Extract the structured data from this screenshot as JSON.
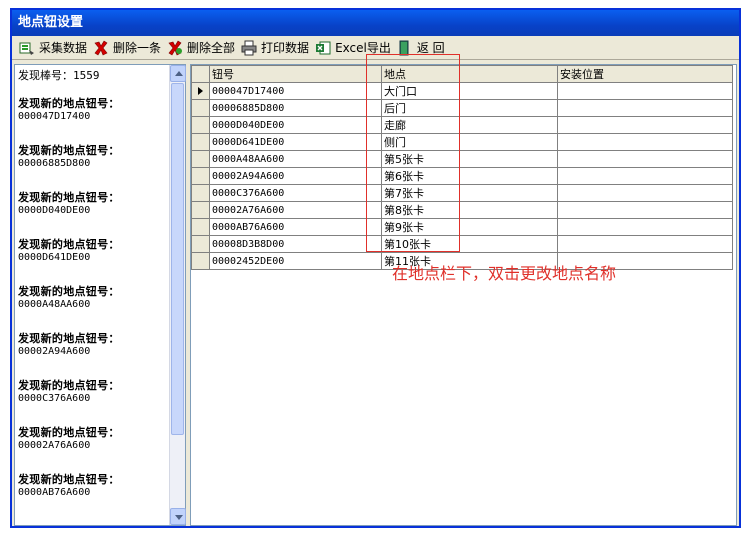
{
  "window": {
    "title": "地点钮设置"
  },
  "toolbar": {
    "collect": "采集数据",
    "delete_one": "删除一条",
    "delete_all": "删除全部",
    "print": "打印数据",
    "excel": "Excel导出",
    "back": "返  回"
  },
  "left_panel": {
    "count_text": "发现棒号：1559",
    "entries": [
      {
        "label": "发现新的地点钮号：",
        "code": "000047D17400"
      },
      {
        "label": "发现新的地点钮号：",
        "code": "00006885D800"
      },
      {
        "label": "发现新的地点钮号：",
        "code": "0000D040DE00"
      },
      {
        "label": "发现新的地点钮号：",
        "code": "0000D641DE00"
      },
      {
        "label": "发现新的地点钮号：",
        "code": "0000A48AA600"
      },
      {
        "label": "发现新的地点钮号：",
        "code": "00002A94A600"
      },
      {
        "label": "发现新的地点钮号：",
        "code": "0000C376A600"
      },
      {
        "label": "发现新的地点钮号：",
        "code": "00002A76A600"
      },
      {
        "label": "发现新的地点钮号：",
        "code": "0000AB76A600"
      }
    ]
  },
  "grid": {
    "headers": [
      "钮号",
      "地点",
      "安装位置"
    ],
    "rows": [
      {
        "code": "000047D17400",
        "loc": "大门口",
        "pos": ""
      },
      {
        "code": "00006885D800",
        "loc": "后门",
        "pos": ""
      },
      {
        "code": "0000D040DE00",
        "loc": "走廊",
        "pos": ""
      },
      {
        "code": "0000D641DE00",
        "loc": "侧门",
        "pos": ""
      },
      {
        "code": "0000A48AA600",
        "loc": "第5张卡",
        "pos": ""
      },
      {
        "code": "00002A94A600",
        "loc": "第6张卡",
        "pos": ""
      },
      {
        "code": "0000C376A600",
        "loc": "第7张卡",
        "pos": ""
      },
      {
        "code": "00002A76A600",
        "loc": "第8张卡",
        "pos": ""
      },
      {
        "code": "0000AB76A600",
        "loc": "第9张卡",
        "pos": ""
      },
      {
        "code": "00008D3B8D00",
        "loc": "第10张卡",
        "pos": ""
      },
      {
        "code": "00002452DE00",
        "loc": "第11张卡",
        "pos": ""
      }
    ]
  },
  "annotation": "在地点栏下，双击更改地点名称",
  "colors": {
    "highlight": "#e0302a",
    "titlebar": "#0842c8"
  }
}
